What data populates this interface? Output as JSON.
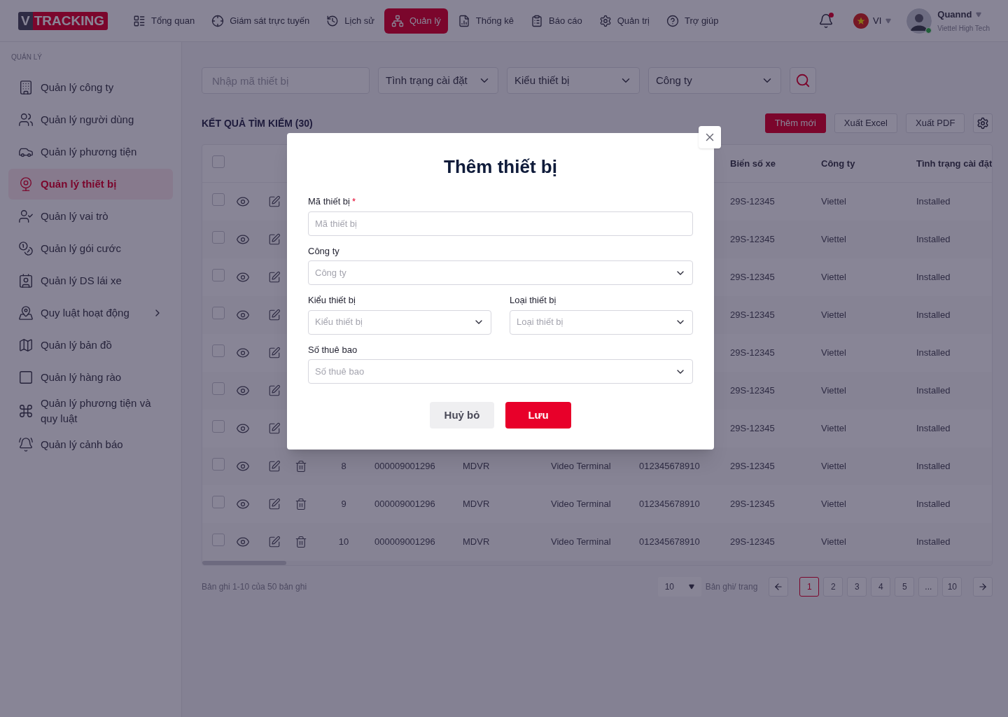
{
  "header": {
    "logo": {
      "letter": "V",
      "word": "TRACKING"
    },
    "nav": [
      {
        "label": "Tổng quan",
        "selected": false
      },
      {
        "label": "Giám sát trực tuyến",
        "selected": false
      },
      {
        "label": "Lịch sử",
        "selected": false
      },
      {
        "label": "Quản lý",
        "selected": true
      },
      {
        "label": "Thống kê",
        "selected": false
      },
      {
        "label": "Báo cáo",
        "selected": false
      },
      {
        "label": "Quản trị",
        "selected": false
      },
      {
        "label": "Trợ giúp",
        "selected": false
      }
    ],
    "notifications_unread": true,
    "language": "VI",
    "user": {
      "name": "Quannd",
      "company": "Viettel High Tech",
      "online": true
    }
  },
  "sidebar": {
    "heading": "QUẢN LÝ",
    "items": [
      {
        "label": "Quản lý công ty",
        "selected": false,
        "has_submenu": false
      },
      {
        "label": "Quản lý người dùng",
        "selected": false,
        "has_submenu": false
      },
      {
        "label": "Quản lý phương tiện",
        "selected": false,
        "has_submenu": false
      },
      {
        "label": "Quản lý thiết bị",
        "selected": true,
        "has_submenu": false
      },
      {
        "label": "Quản lý vai trò",
        "selected": false,
        "has_submenu": false
      },
      {
        "label": "Quản lý gói cước",
        "selected": false,
        "has_submenu": false
      },
      {
        "label": "Quản lý DS lái xe",
        "selected": false,
        "has_submenu": false
      },
      {
        "label": "Quy luật hoạt động",
        "selected": false,
        "has_submenu": true
      },
      {
        "label": "Quản lý bản đồ",
        "selected": false,
        "has_submenu": false
      },
      {
        "label": "Quản lý hàng rào",
        "selected": false,
        "has_submenu": false
      },
      {
        "label": "Quản lý phương tiện và quy luật",
        "selected": false,
        "has_submenu": false
      },
      {
        "label": "Quản lý cảnh báo",
        "selected": false,
        "has_submenu": false
      }
    ]
  },
  "filters": {
    "search": {
      "placeholder": "Nhập mã thiết bị"
    },
    "selects": [
      "Tình trạng cài đặt",
      "Kiểu thiết bị",
      "Công ty"
    ]
  },
  "results": {
    "title": "KẾT QUẢ TÌM KIẾM (30)",
    "actions": [
      {
        "label": "Thêm mới",
        "kind": "primary"
      },
      {
        "label": "Xuất Excel",
        "kind": "outline"
      },
      {
        "label": "Xuất PDF",
        "kind": "outline"
      }
    ]
  },
  "table": {
    "all_checked": false,
    "columns": {
      "plate": "Biển số xe",
      "company": "Công ty",
      "status": "Tình trạng cài đặt"
    },
    "rows": [
      {
        "checked": false,
        "plate": "29S-12345",
        "company": "Viettel",
        "status": "Installed"
      },
      {
        "checked": false,
        "plate": "29S-12345",
        "company": "Viettel",
        "status": "Installed"
      },
      {
        "checked": false,
        "plate": "29S-12345",
        "company": "Viettel",
        "status": "Installed"
      },
      {
        "checked": false,
        "plate": "29S-12345",
        "company": "Viettel",
        "status": "Installed"
      },
      {
        "checked": false,
        "plate": "29S-12345",
        "company": "Viettel",
        "status": "Installed"
      },
      {
        "checked": false,
        "plate": "29S-12345",
        "company": "Viettel",
        "status": "Installed"
      },
      {
        "checked": false,
        "plate": "29S-12345",
        "company": "Viettel",
        "status": "Installed"
      },
      {
        "checked": false,
        "index": "8",
        "device_id": "000009001296",
        "type": "MDVR",
        "model": "Video Terminal",
        "subscriber": "012345678910",
        "plate": "29S-12345",
        "company": "Viettel",
        "status": "Installed"
      },
      {
        "checked": false,
        "index": "9",
        "device_id": "000009001296",
        "type": "MDVR",
        "model": "Video Terminal",
        "subscriber": "012345678910",
        "plate": "29S-12345",
        "company": "Viettel",
        "status": "Installed"
      },
      {
        "checked": false,
        "index": "10",
        "device_id": "000009001296",
        "type": "MDVR",
        "model": "Video Terminal",
        "subscriber": "012345678910",
        "plate": "29S-12345",
        "company": "Viettel",
        "status": "Installed"
      }
    ]
  },
  "pagination": {
    "summary": "Bản ghi 1-10 của 50 bản ghi",
    "page_size": "10",
    "page_size_label": "Bản ghi/ trang",
    "pages": [
      {
        "label": "1",
        "selected": true
      },
      {
        "label": "2",
        "selected": false
      },
      {
        "label": "3",
        "selected": false
      },
      {
        "label": "4",
        "selected": false
      },
      {
        "label": "5",
        "selected": false
      },
      {
        "label": "...",
        "selected": false
      },
      {
        "label": "10",
        "selected": false
      }
    ]
  },
  "dialog": {
    "title": "Thêm thiết bị",
    "rows": [
      [
        {
          "label": "Mã thiết bị",
          "required": true,
          "kind": "text",
          "placeholder": "Mã thiết bị"
        }
      ],
      [
        {
          "label": "Công ty",
          "required": false,
          "kind": "select",
          "placeholder": "Công ty"
        }
      ],
      [
        {
          "label": "Kiểu thiết bị",
          "required": false,
          "kind": "select",
          "placeholder": "Kiểu thiết bị"
        },
        {
          "label": "Loại thiết bị",
          "required": false,
          "kind": "select",
          "placeholder": "Loại thiết bị"
        }
      ],
      [
        {
          "label": "Số thuê bao",
          "required": false,
          "kind": "select",
          "placeholder": "Số thuê bao"
        }
      ]
    ],
    "required_mark": "*",
    "buttons": [
      {
        "label": "Huỷ bỏ",
        "kind": "secondary"
      },
      {
        "label": "Lưu",
        "kind": "primary"
      }
    ]
  }
}
